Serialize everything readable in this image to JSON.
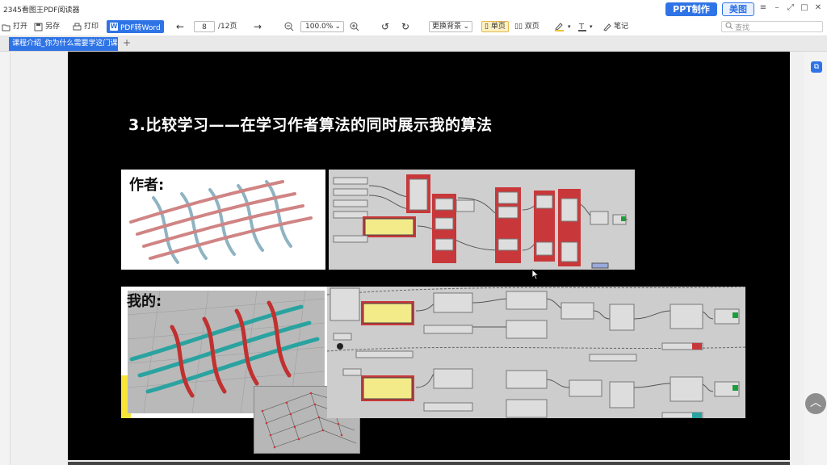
{
  "app": {
    "title": "2345看图王PDF阅读器"
  },
  "header": {
    "ppt_label": "PPT制作",
    "meitu_label": "美图"
  },
  "toolbar": {
    "open_label": "打开",
    "saveas_label": "另存",
    "print_label": "打印",
    "pdf_word_label": "PDF转Word",
    "page_current": "8",
    "page_total": "/12页",
    "zoom": "100.0%",
    "background_label": "更换背景",
    "single_page_label": "单页",
    "double_page_label": "双页",
    "notes_label": "笔记",
    "search_placeholder": "查找"
  },
  "tabs": [
    {
      "label": "课程介绍_你为什么需要学这门课"
    }
  ],
  "slide": {
    "title": "3.比较学习——在学习作者算法的同时展示我的算法",
    "author_label": "作者:",
    "mine_label": "我的:"
  },
  "colors": {
    "accent": "#2f74e6",
    "slide_bg": "#000000",
    "node_red": "#c8383a",
    "yarn_red": "#c44a4a",
    "yarn_teal": "#2aa3a0"
  },
  "icons": [
    "open-icon",
    "save-icon",
    "print-icon",
    "word-icon",
    "arrow-left-icon",
    "arrow-right-icon",
    "zoom-out-icon",
    "zoom-in-icon",
    "rotate-left-icon",
    "rotate-right-icon",
    "highlight-icon",
    "text-icon",
    "note-icon",
    "search-icon",
    "scroll-top-icon"
  ]
}
